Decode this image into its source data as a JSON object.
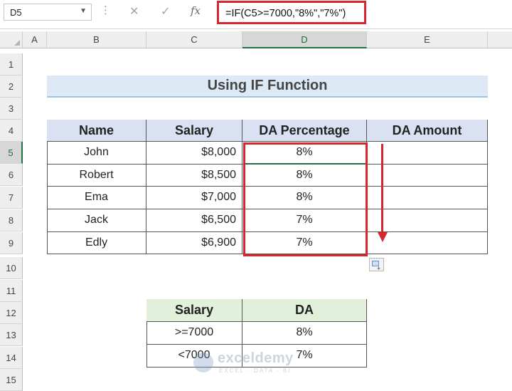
{
  "formula_bar": {
    "name_box": "D5",
    "formula": "=IF(C5>=7000,\"8%\",\"7%\")",
    "icons": {
      "cancel": "close-icon",
      "enter": "check-icon",
      "function": "fx-icon"
    }
  },
  "columns": [
    "A",
    "B",
    "C",
    "D",
    "E"
  ],
  "selected_column": "D",
  "rows": [
    "1",
    "2",
    "3",
    "4",
    "5",
    "6",
    "7",
    "8",
    "9",
    "10",
    "11",
    "12",
    "13",
    "14",
    "15"
  ],
  "selected_row": "5",
  "title": "Using IF Function",
  "main_table": {
    "headers": [
      "Name",
      "Salary",
      "DA Percentage",
      "DA Amount"
    ],
    "rows": [
      {
        "name": "John",
        "salary": "$8,000",
        "da_percentage": "8%",
        "da_amount": ""
      },
      {
        "name": "Robert",
        "salary": "$8,500",
        "da_percentage": "8%",
        "da_amount": ""
      },
      {
        "name": "Ema",
        "salary": "$7,000",
        "da_percentage": "8%",
        "da_amount": ""
      },
      {
        "name": "Jack",
        "salary": "$6,500",
        "da_percentage": "7%",
        "da_amount": ""
      },
      {
        "name": "Edly",
        "salary": "$6,900",
        "da_percentage": "7%",
        "da_amount": ""
      }
    ]
  },
  "criteria_table": {
    "headers": [
      "Salary",
      "DA"
    ],
    "rows": [
      {
        "salary": ">=7000",
        "da": "8%"
      },
      {
        "salary": "<7000",
        "da": "7%"
      }
    ]
  },
  "watermark": {
    "name": "exceldemy",
    "tagline": "EXCEL · DATA · BI"
  },
  "colors": {
    "highlight_red": "#d6262f",
    "title_band": "#dde9f4",
    "header_blue": "#d9e1f2",
    "header_green": "#e2efda",
    "excel_green": "#217346"
  }
}
